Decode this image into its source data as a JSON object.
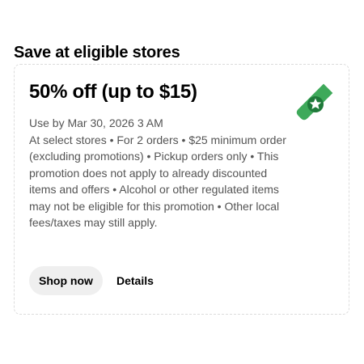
{
  "section": {
    "title": "Save at eligible stores"
  },
  "offer": {
    "title": "50% off (up to $15)",
    "expiry": "Use by Mar 30, 2026 3 AM",
    "terms": "At select stores • For 2 orders • $25 minimum order (excluding promotions) • Pickup orders only • This promotion does not apply to already discounted items and offers • Alcohol or other regulated items may not be eligible for this promotion • Other local fees/taxes may still apply.",
    "icon": "promo-tag-icon",
    "icon_color": "#3ea95a",
    "icon_accent": "#1f7a3a"
  },
  "actions": {
    "shop_now_label": "Shop now",
    "details_label": "Details"
  }
}
